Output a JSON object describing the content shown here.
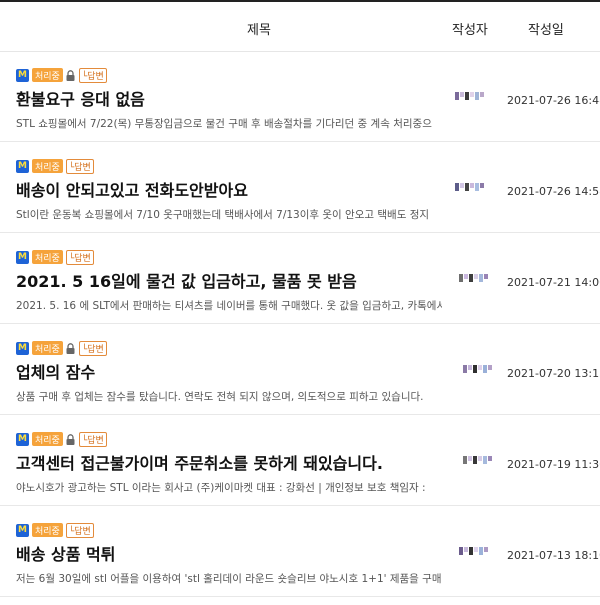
{
  "header": {
    "title": "제목",
    "author": "작성자",
    "date": "작성일"
  },
  "badges": {
    "m": "M",
    "status": "처리중",
    "reply": "└답변"
  },
  "colors": {
    "m_bg": "#1e63d6",
    "status_bg": "#f5a33b",
    "reply_border": "#e38b3b"
  },
  "posts": [
    {
      "locked": true,
      "title": "환불요구 응대 없음",
      "preview": "STL 쇼핑몰에서 7/22(목) 무통장입금으로 물건 구매 후 배송절차를 기다리던 중 계속 처리중으",
      "date": "2021-07-26 16:48"
    },
    {
      "locked": false,
      "title": "배송이 안되고있고 전화도안받아요",
      "preview": "Stl이란 운동복 쇼핑몰에서 7/10 옷구매했는데 택배사에서 7/13이후 옷이 안오고 택배도 정지",
      "date": "2021-07-26 14:58"
    },
    {
      "locked": false,
      "title": "2021. 5 16일에 물건 값 입금하고, 물품 못 받음",
      "preview": "2021. 5. 16 에 SLT에서 판매하는 티셔츠를 네이버를 통해 구매했다. 옷 값을 입금하고, 카톡에서",
      "date": "2021-07-21 14:06"
    },
    {
      "locked": true,
      "title": "업체의 잠수",
      "preview": "상품 구매 후 업체는 잠수를 탔습니다. 연락도 전혀 되지 않으며, 의도적으로 피하고 있습니다.",
      "date": "2021-07-20 13:15"
    },
    {
      "locked": true,
      "title": "고객센터 접근불가이며 주문취소를 못하게 돼있습니다.",
      "preview": "야노시호가 광고하는 STL 이라는 회사고 (주)케이마켓 대표 : 강화선  |  개인정보 보호 책임자 :",
      "date": "2021-07-19 11:36"
    },
    {
      "locked": false,
      "title": "배송 상품 먹튀",
      "preview": "저는 6월 30일에 stl 어플을 이용하여 'stl 홀리데이 라운드 숏슬리브 야노시호 1+1' 제품을 구매",
      "date": "2021-07-13 18:10"
    }
  ]
}
